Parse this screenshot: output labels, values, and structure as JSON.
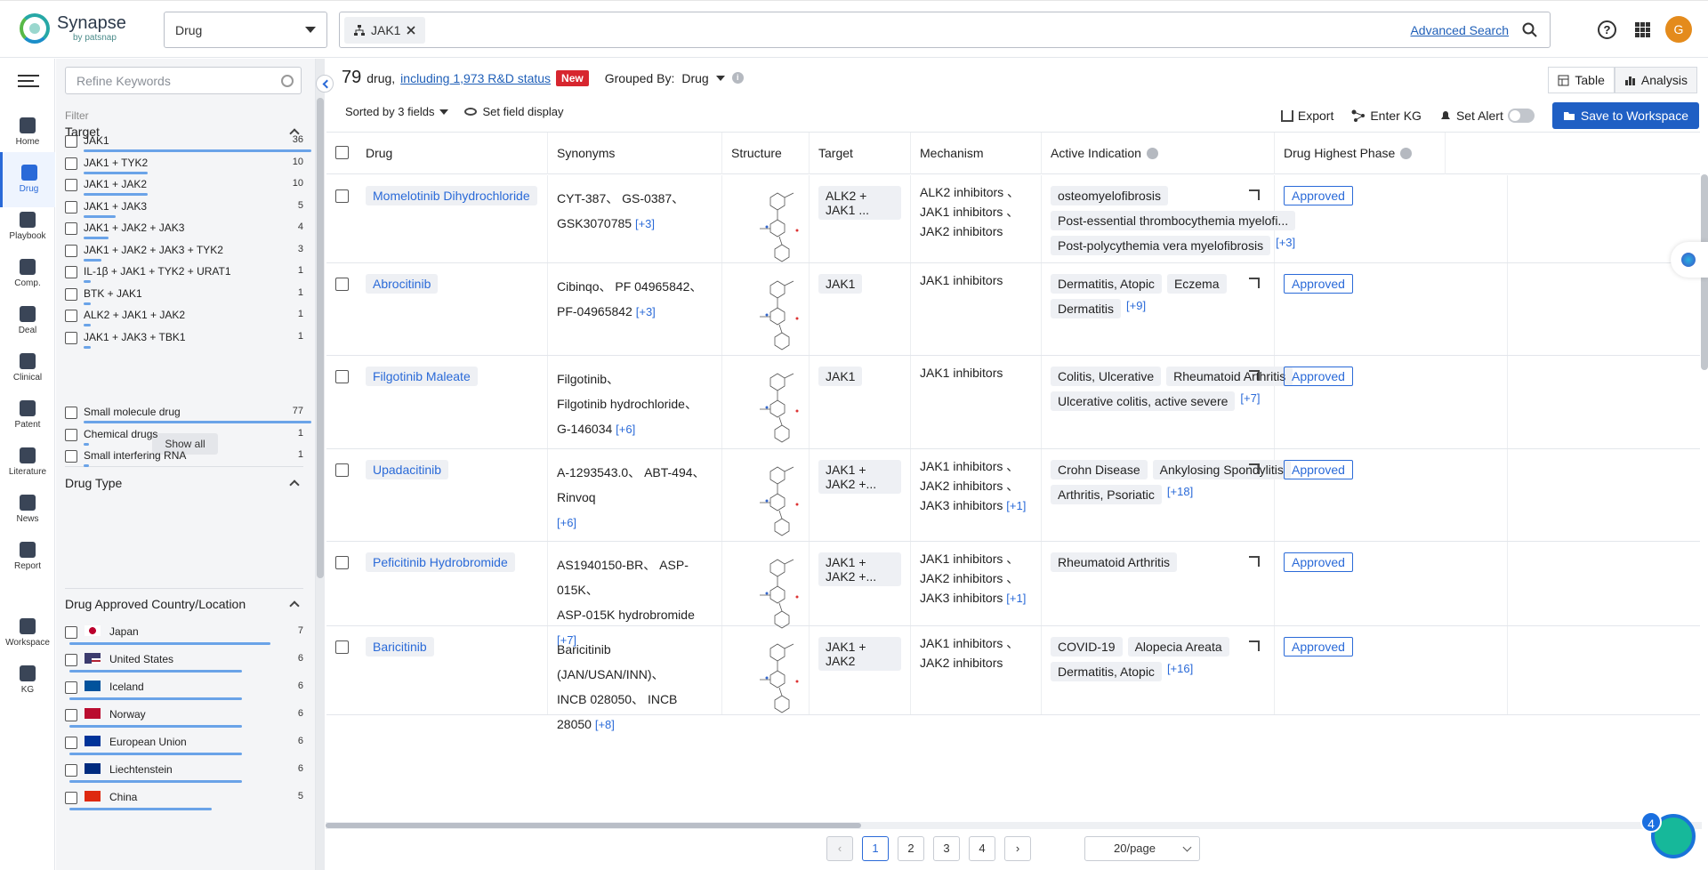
{
  "header": {
    "logo_name": "Synapse",
    "logo_sub": "by patsnap",
    "search_type": "Drug",
    "search_tag": "JAK1",
    "advanced_search": "Advanced Search",
    "help_icon": "question-circle-icon",
    "apps_icon": "grid-icon",
    "avatar_letter": "G"
  },
  "nav": {
    "items": [
      {
        "label": "Home",
        "icon": "home-icon"
      },
      {
        "label": "Drug",
        "icon": "pill-icon"
      },
      {
        "label": "Playbook",
        "icon": "playbook-icon"
      },
      {
        "label": "Comp.",
        "icon": "tools-icon"
      },
      {
        "label": "Deal",
        "icon": "deal-icon"
      },
      {
        "label": "Clinical",
        "icon": "clipboard-icon"
      },
      {
        "label": "Patent",
        "icon": "patent-icon"
      },
      {
        "label": "Literature",
        "icon": "document-icon"
      },
      {
        "label": "News",
        "icon": "news-icon"
      },
      {
        "label": "Report",
        "icon": "report-icon"
      },
      {
        "label": "Workspace",
        "icon": "workspace-icon"
      },
      {
        "label": "KG",
        "icon": "graph-icon"
      }
    ]
  },
  "filter": {
    "keywords_placeholder": "Refine Keywords",
    "filter_label": "Filter",
    "target_title": "Target",
    "target_items": [
      {
        "label": "JAK1",
        "count": "36",
        "frac": 1.0
      },
      {
        "label": "JAK1 + TYK2",
        "count": "10",
        "frac": 0.28
      },
      {
        "label": "JAK1 + JAK2",
        "count": "10",
        "frac": 0.28
      },
      {
        "label": "JAK1 + JAK3",
        "count": "5",
        "frac": 0.14
      },
      {
        "label": "JAK1 + JAK2 + JAK3",
        "count": "4",
        "frac": 0.11
      },
      {
        "label": "JAK1 + JAK2 + JAK3 + TYK2",
        "count": "3",
        "frac": 0.08
      },
      {
        "label": "IL-1β + JAK1 + TYK2 + URAT1",
        "count": "1",
        "frac": 0.03
      },
      {
        "label": "BTK + JAK1",
        "count": "1",
        "frac": 0.03
      },
      {
        "label": "ALK2 + JAK1 + JAK2",
        "count": "1",
        "frac": 0.03
      },
      {
        "label": "JAK1 + JAK3 + TBK1",
        "count": "1",
        "frac": 0.03
      }
    ],
    "show_all": "Show all",
    "drugtype_title": "Drug Type",
    "drugtype_items": [
      {
        "label": "Small molecule drug",
        "count": "77",
        "frac": 1.0
      },
      {
        "label": "Chemical drugs",
        "count": "1",
        "frac": 0.02
      },
      {
        "label": "Small interfering RNA",
        "count": "1",
        "frac": 0.02
      }
    ],
    "country_title": "Drug Approved Country/Location",
    "country_items": [
      {
        "label": "Japan",
        "count": "7",
        "frac": 1.0,
        "flag": "japan-flag-icon"
      },
      {
        "label": "United States",
        "count": "6",
        "frac": 0.86,
        "flag": "us-flag-icon"
      },
      {
        "label": "Iceland",
        "count": "6",
        "frac": 0.86,
        "flag": "iceland-flag-icon"
      },
      {
        "label": "Norway",
        "count": "6",
        "frac": 0.86,
        "flag": "norway-flag-icon"
      },
      {
        "label": "European Union",
        "count": "6",
        "frac": 0.86,
        "flag": "eu-flag-icon"
      },
      {
        "label": "Liechtenstein",
        "count": "6",
        "frac": 0.86,
        "flag": "liechtenstein-flag-icon"
      },
      {
        "label": "China",
        "count": "5",
        "frac": 0.71,
        "flag": "china-flag-icon"
      }
    ]
  },
  "results": {
    "count": "79",
    "count_suffix": "drug,",
    "rd_link": "including 1,973 R&D status",
    "new_badge": "New",
    "grouped_label": "Grouped By:",
    "grouped_value": "Drug",
    "sorted": "Sorted by 3 fields",
    "set_field": "Set field display",
    "export": "Export",
    "enter_kg": "Enter KG",
    "set_alert": "Set Alert",
    "save": "Save to Workspace",
    "tab_table": "Table",
    "tab_analysis": "Analysis"
  },
  "table": {
    "columns": [
      "Drug",
      "Synonyms",
      "Structure",
      "Target",
      "Mechanism",
      "Active Indication",
      "Drug Highest Phase"
    ],
    "rows": [
      {
        "drug": "Momelotinib Dihydrochloride",
        "syn": [
          "CYT-387、 GS-0387、",
          "GSK3070785"
        ],
        "syn_more": "[+3]",
        "target": "ALK2 + JAK1 ...",
        "mech": [
          "ALK2 inhibitors 、",
          "JAK1 inhibitors 、",
          "JAK2 inhibitors"
        ],
        "mech_more": "",
        "ind": [
          "osteomyelofibrosis",
          "Post-essential thrombocythemia myelofi...",
          "Post-polycythemia vera myelofibrosis"
        ],
        "ind_more": "[+3]",
        "phase": "Approved"
      },
      {
        "drug": "Abrocitinib",
        "syn": [
          "Cibinqo、 PF 04965842、",
          "PF-04965842"
        ],
        "syn_more": "[+3]",
        "target": "JAK1",
        "mech": [
          "JAK1 inhibitors"
        ],
        "mech_more": "",
        "ind": [
          "Dermatitis, Atopic",
          "Eczema",
          "Dermatitis"
        ],
        "ind_more": "[+9]",
        "phase": "Approved"
      },
      {
        "drug": "Filgotinib Maleate",
        "syn": [
          "Filgotinib、",
          "Filgotinib hydrochloride、",
          "G-146034"
        ],
        "syn_more": "[+6]",
        "target": "JAK1",
        "mech": [
          "JAK1 inhibitors"
        ],
        "mech_more": "",
        "ind": [
          "Colitis, Ulcerative",
          "Rheumatoid Arthritis",
          "Ulcerative colitis, active severe"
        ],
        "ind_more": "[+7]",
        "phase": "Approved"
      },
      {
        "drug": "Upadacitinib",
        "syn": [
          "A-1293543.0、 ABT-494、 Rinvoq",
          ""
        ],
        "syn_more": "[+6]",
        "target": "JAK1 + JAK2 +...",
        "mech": [
          "JAK1 inhibitors 、",
          "JAK2 inhibitors 、",
          "JAK3 inhibitors"
        ],
        "mech_more": "[+1]",
        "ind": [
          "Crohn Disease",
          "Ankylosing Spondylitis",
          "Arthritis, Psoriatic"
        ],
        "ind_more": "[+18]",
        "phase": "Approved"
      },
      {
        "drug": "Peficitinib Hydrobromide",
        "syn": [
          "AS1940150-BR、 ASP-015K、",
          "ASP-015K hydrobromide"
        ],
        "syn_more": "[+7]",
        "target": "JAK1 + JAK2 +...",
        "mech": [
          "JAK1 inhibitors 、",
          "JAK2 inhibitors 、",
          "JAK3 inhibitors"
        ],
        "mech_more": "[+1]",
        "ind": [
          "Rheumatoid Arthritis"
        ],
        "ind_more": "",
        "phase": "Approved"
      },
      {
        "drug": "Baricitinib",
        "syn": [
          "Baricitinib (JAN/USAN/INN)、",
          "INCB 028050、 INCB 28050"
        ],
        "syn_more": "[+8]",
        "target": "JAK1 + JAK2",
        "mech": [
          "JAK1 inhibitors 、",
          "JAK2 inhibitors"
        ],
        "mech_more": "",
        "ind": [
          "COVID-19",
          "Alopecia Areata",
          "Dermatitis, Atopic"
        ],
        "ind_more": "[+16]",
        "phase": "Approved"
      }
    ]
  },
  "pagination": {
    "pages": [
      "1",
      "2",
      "3",
      "4"
    ],
    "current": "1",
    "per_page": "20/page",
    "prev_icon": "chevron-left-icon",
    "next_icon": "chevron-right-icon"
  },
  "assistant": {
    "badge": "4"
  }
}
